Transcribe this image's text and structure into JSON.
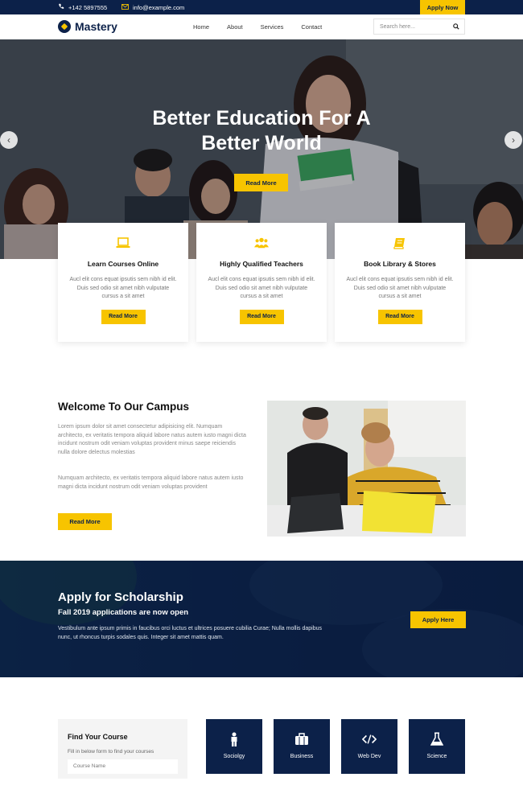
{
  "topbar": {
    "phone": "+142 5897555",
    "email": "info@example.com",
    "apply_label": "Apply Now"
  },
  "nav": {
    "brand": "Mastery",
    "menu": [
      "Home",
      "About",
      "Services",
      "Contact"
    ],
    "search_placeholder": "Search here..."
  },
  "hero": {
    "title_line1": "Better Education For A",
    "title_line2": "Better World",
    "button": "Read More"
  },
  "features": [
    {
      "icon": "laptop-icon",
      "title": "Learn Courses Online",
      "text": "Aucl elit cons equat ipsutis sem nibh id elit. Duis sed odio sit amet nibh vulputate cursus a sit amet",
      "button": "Read More"
    },
    {
      "icon": "users-icon",
      "title": "Highly Qualified Teachers",
      "text": "Aucl elit cons equat ipsutis sem nibh id elit. Duis sed odio sit amet nibh vulputate cursus a sit amet",
      "button": "Read More"
    },
    {
      "icon": "book-icon",
      "title": "Book Library & Stores",
      "text": "Aucl elit cons equat ipsutis sem nibh id elit. Duis sed odio sit amet nibh vulputate cursus a sit amet",
      "button": "Read More"
    }
  ],
  "campus": {
    "title": "Welcome To Our Campus",
    "para1": "Lorem ipsum dolor sit amet consectetur adipisicing elit. Numquam architecto, ex veritatis tempora aliquid labore natus autem iusto magni dicta incidunt nostrum odit veniam voluptas provident minus saepe reiciendis nulla dolore delectus molestias",
    "para2": "Numquam architecto, ex veritatis tempora aliquid labore natus autem iusto magni dicta incidunt nostrum odit veniam voluptas provident",
    "button": "Read More"
  },
  "scholarship": {
    "title": "Apply for Scholarship",
    "subtitle": "Fall 2019 applications are now open",
    "text": "Vestibulum ante ipsum primis in faucibus orci luctus et ultrices posuere cubilia Curae; Nulla mollis dapibus nunc, ut rhoncus turpis sodales quis. Integer sit amet mattis quam.",
    "button": "Apply Here"
  },
  "find_course": {
    "title": "Find Your Course",
    "subtitle": "Fill in below form to find your courses",
    "field_placeholder": "Course Name"
  },
  "courses": [
    {
      "icon": "person-icon",
      "label": "Sociolgy"
    },
    {
      "icon": "briefcase-icon",
      "label": "Business"
    },
    {
      "icon": "code-icon",
      "label": "Web Dev"
    },
    {
      "icon": "flask-icon",
      "label": "Science"
    }
  ],
  "colors": {
    "navy": "#0c2149",
    "accent": "#f7c400"
  }
}
